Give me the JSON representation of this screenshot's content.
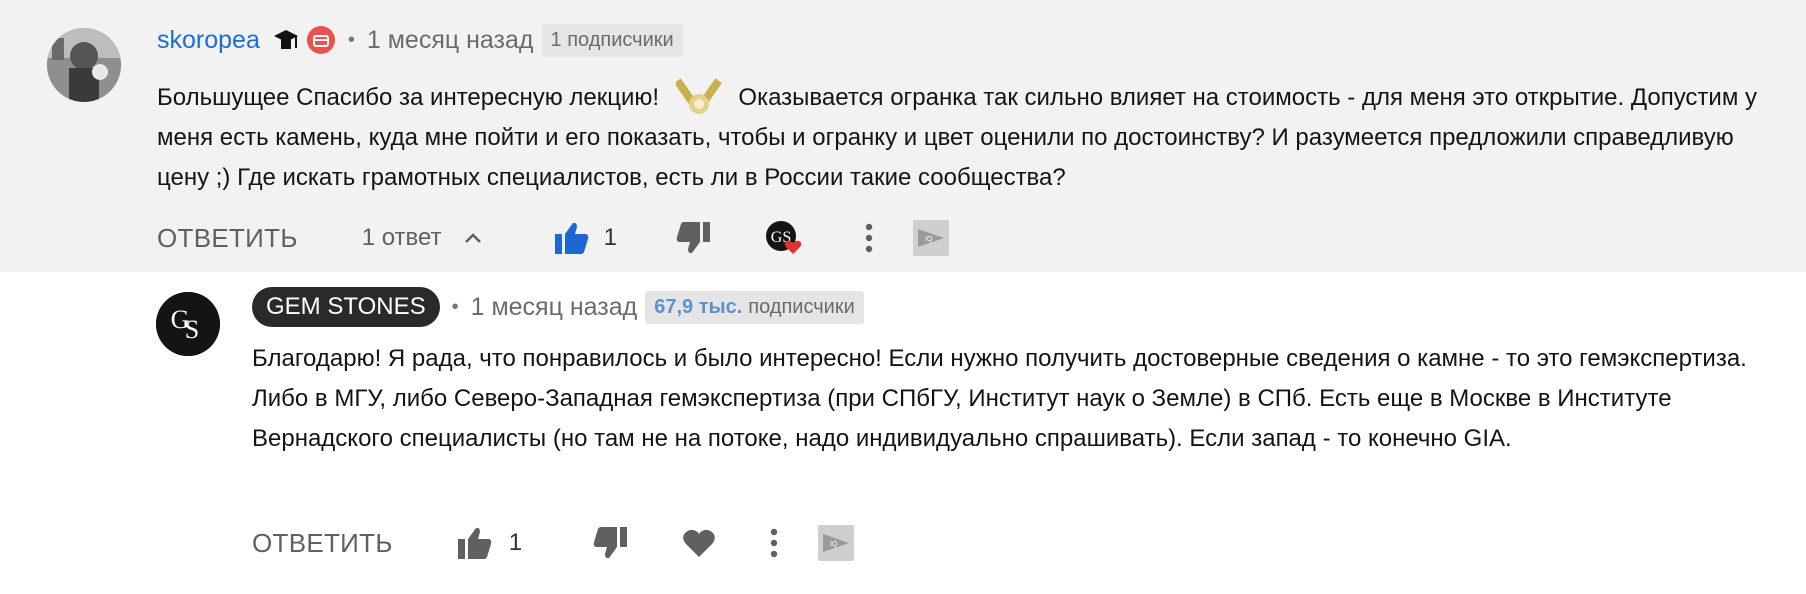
{
  "comment": {
    "author": "skoropea",
    "time": "1 месяц назад",
    "subscribers_label": "1 подписчики",
    "text_part1": "Большущее Спасибо за интересную лекцию!",
    "text_part2": "Оказывается огранка так сильно влияет на стоимость - для меня это открытие. Допустим у меня есть камень, куда мне пойти и его показать, чтобы и огранку и цвет оценили по достоинству? И разумеется предложили справедливую цену ;) Где искать грамотных специалистов, есть ли в России такие сообщества?",
    "reply_label": "ОТВЕТИТЬ",
    "replies_label": "1 ответ",
    "like_count": "1"
  },
  "reply": {
    "author": "GEM STONES",
    "time": "1 месяц назад",
    "subscribers_count": "67,9 тыс.",
    "subscribers_word": "подписчики",
    "text": "Благодарю! Я рада, что понравилось и было интересно! Если нужно получить достоверные сведения о камне - то это гемэкспертиза. Либо в МГУ, либо Северо-Западная гемэкспертиза (при СПбГУ, Институт наук о Земле) в СПб. Есть еще в Москве в Институте Вернадского специалисты (но там не на потоке, надо индивидуально спрашивать). Если запад - то конечно  GIA.",
    "reply_label": "ОТВЕТИТЬ",
    "like_count": "1"
  },
  "icons": {
    "badge1": "graduation-cap-icon",
    "badge2": "pink-badge-icon",
    "emoji": "ring-emoji-icon",
    "like": "thumbs-up-icon",
    "dislike": "thumbs-down-icon",
    "heart": "heart-icon",
    "more": "more-vert-icon",
    "iq": "iq-extension-icon"
  },
  "colors": {
    "link_blue": "#1a6fd0",
    "like_active": "#1e66d4",
    "heart_red": "#e0312f",
    "top_bg": "#f2f2f2"
  }
}
